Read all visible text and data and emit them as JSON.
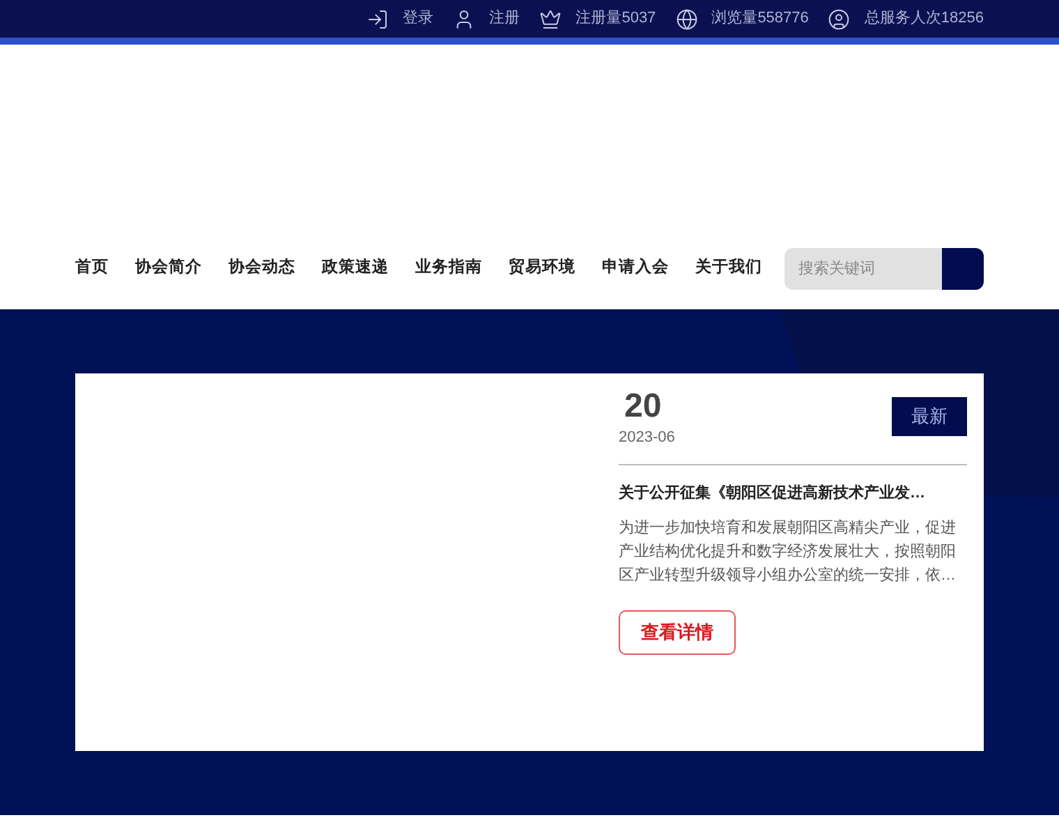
{
  "top_bar": {
    "items": [
      {
        "kind": "login",
        "label": "登录"
      },
      {
        "kind": "register",
        "label": "注册"
      },
      {
        "kind": "registered",
        "label": "注册量5037"
      },
      {
        "kind": "views",
        "label": "浏览量558776"
      },
      {
        "kind": "served",
        "label": "总服务人次18256"
      }
    ]
  },
  "nav": {
    "items": [
      "首页",
      "协会简介",
      "协会动态",
      "政策速递",
      "业务指南",
      "贸易环境",
      "申请入会",
      "关于我们"
    ]
  },
  "search": {
    "placeholder": "搜索关键词"
  },
  "news_card": {
    "day": "20",
    "month": "2023-06",
    "badge": "最新",
    "title": "关于公开征集《朝阳区促进高新技术产业发…",
    "summary": "为进一步加快培育和发展朝阳区高精尖产业，促进产业结构优化提升和数字经济发展壮大，按照朝阳区产业转型升级领导小组办公室的统一安排，依…",
    "button": "查看详情"
  }
}
